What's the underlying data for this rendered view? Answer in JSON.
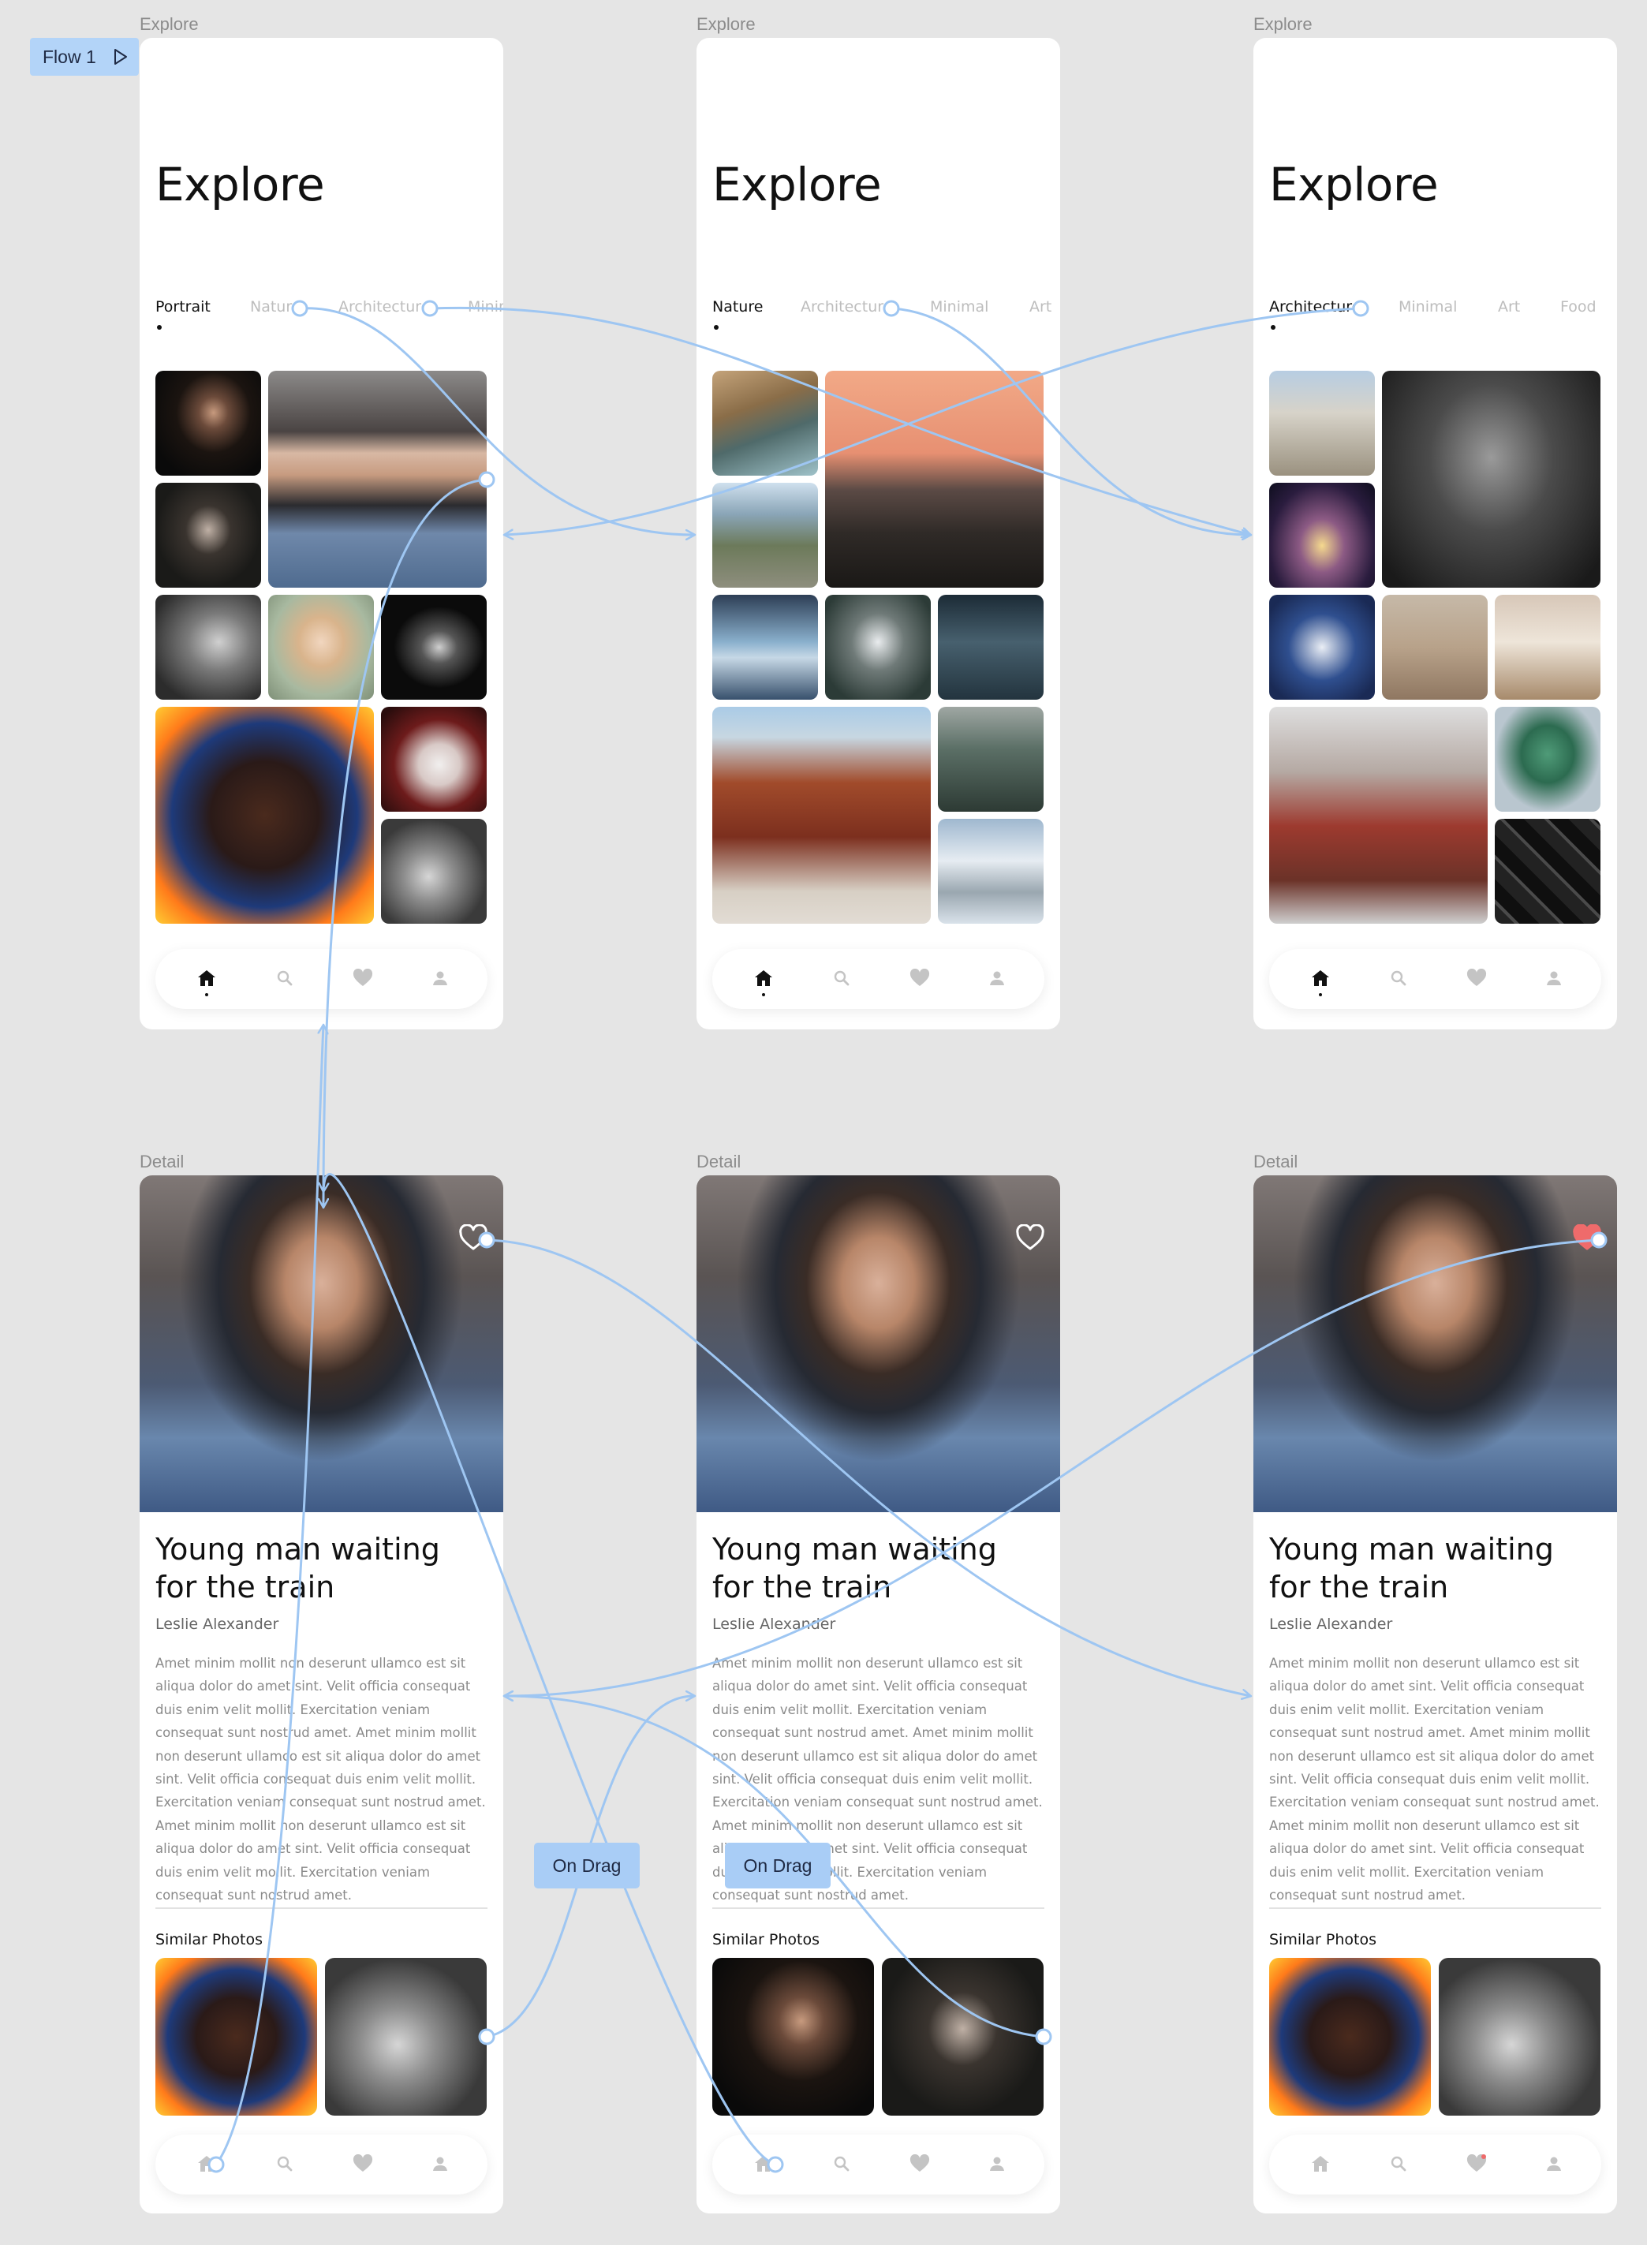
{
  "flow": {
    "label": "Flow 1"
  },
  "explore_frames": [
    {
      "frame_label": "Explore",
      "title": "Explore",
      "tabs": [
        {
          "label": "Portrait",
          "active": true
        },
        {
          "label": "Nature",
          "active": false
        },
        {
          "label": "Architecture",
          "active": false
        },
        {
          "label": "Minimal",
          "active": false
        }
      ]
    },
    {
      "frame_label": "Explore",
      "title": "Explore",
      "tabs": [
        {
          "label": "Nature",
          "active": true
        },
        {
          "label": "Architecture",
          "active": false
        },
        {
          "label": "Minimal",
          "active": false
        },
        {
          "label": "Art",
          "active": false
        }
      ]
    },
    {
      "frame_label": "Explore",
      "title": "Explore",
      "tabs": [
        {
          "label": "Architecture",
          "active": true
        },
        {
          "label": "Minimal",
          "active": false
        },
        {
          "label": "Art",
          "active": false
        },
        {
          "label": "Food",
          "active": false
        }
      ]
    }
  ],
  "detail_frames": [
    {
      "frame_label": "Detail",
      "title": "Young man waiting for the train",
      "author": "Leslie Alexander",
      "body": "Amet minim mollit non deserunt ullamco est sit aliqua dolor do amet sint. Velit officia consequat duis enim velit mollit. Exercitation veniam consequat sunt nostrud amet. Amet minim mollit non deserunt ullamco est sit aliqua dolor do amet sint. Velit officia consequat duis enim velit mollit. Exercitation veniam consequat sunt nostrud amet. Amet minim mollit non deserunt ullamco est sit aliqua dolor do amet sint. Velit officia consequat duis enim velit mollit. Exercitation veniam consequat sunt nostrud amet.",
      "similar_heading": "Similar Photos",
      "liked": false
    },
    {
      "frame_label": "Detail",
      "title": "Young man waiting for the train",
      "author": "Leslie Alexander",
      "body": "Amet minim mollit non deserunt ullamco est sit aliqua dolor do amet sint. Velit officia consequat duis enim velit mollit. Exercitation veniam consequat sunt nostrud amet. Amet minim mollit non deserunt ullamco est sit aliqua dolor do amet sint. Velit officia consequat duis enim velit mollit. Exercitation veniam consequat sunt nostrud amet. Amet minim mollit non deserunt ullamco est sit aliqua dolor do amet sint. Velit officia consequat duis enim velit mollit. Exercitation veniam consequat sunt nostrud amet.",
      "similar_heading": "Similar Photos",
      "liked": false
    },
    {
      "frame_label": "Detail",
      "title": "Young man waiting for the train",
      "author": "Leslie Alexander",
      "body": "Amet minim mollit non deserunt ullamco est sit aliqua dolor do amet sint. Velit officia consequat duis enim velit mollit. Exercitation veniam consequat sunt nostrud amet. Amet minim mollit non deserunt ullamco est sit aliqua dolor do amet sint. Velit officia consequat duis enim velit mollit. Exercitation veniam consequat sunt nostrud amet. Amet minim mollit non deserunt ullamco est sit aliqua dolor do amet sint. Velit officia consequat duis enim velit mollit. Exercitation veniam consequat sunt nostrud amet.",
      "similar_heading": "Similar Photos",
      "liked": true
    }
  ],
  "interactions": [
    {
      "trigger": "On Drag"
    },
    {
      "trigger": "On Drag"
    }
  ],
  "navbar": {
    "icons": [
      "home-icon",
      "search-icon",
      "heart-icon",
      "user-icon"
    ]
  },
  "colors": {
    "canvas": "#e5e5e5",
    "prototype_wire": "#9ec6f2",
    "badge": "#b3d4f8",
    "active_text": "#111111",
    "inactive_text": "#bdbdbd",
    "liked_heart": "#ef6b6b"
  }
}
